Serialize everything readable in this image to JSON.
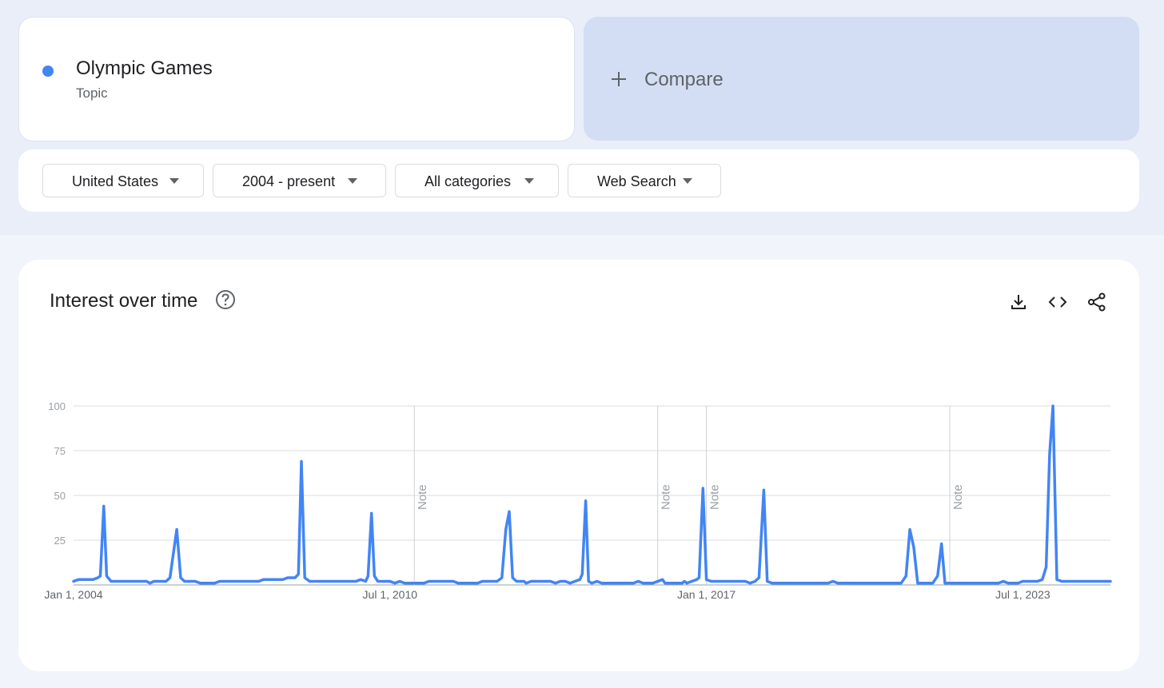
{
  "search_term": {
    "name": "Olympic Games",
    "type": "Topic",
    "color": "#4285f4"
  },
  "compare": {
    "label": "Compare",
    "icon": "plus-icon"
  },
  "filters": {
    "region": "United States",
    "time_range": "2004 - present",
    "category": "All categories",
    "search_type": "Web Search"
  },
  "chart_panel": {
    "title": "Interest over time",
    "icons": [
      "help-icon",
      "download-icon",
      "embed-code-icon",
      "share-icon"
    ]
  },
  "chart_data": {
    "type": "line",
    "title": "Interest over time",
    "xlabel": "",
    "ylabel": "",
    "ylim": [
      0,
      100
    ],
    "yticks": [
      25,
      50,
      75,
      100
    ],
    "xticks": [
      {
        "label": "Jan 1, 2004",
        "t": 2004.0
      },
      {
        "label": "Jul 1, 2010",
        "t": 2010.5
      },
      {
        "label": "Jan 1, 2017",
        "t": 2017.0
      },
      {
        "label": "Jul 1, 2023",
        "t": 2023.5
      }
    ],
    "notes": [
      {
        "label": "Note",
        "t": 2011.0
      },
      {
        "label": "Note",
        "t": 2016.0
      },
      {
        "label": "Note",
        "t": 2017.0
      },
      {
        "label": "Note",
        "t": 2022.0
      }
    ],
    "grid": true,
    "line_color": "#4285f4",
    "series": [
      {
        "points": [
          [
            2004.0,
            2
          ],
          [
            2004.1,
            3
          ],
          [
            2004.4,
            3
          ],
          [
            2004.5,
            4
          ],
          [
            2004.55,
            5
          ],
          [
            2004.62,
            44
          ],
          [
            2004.68,
            5
          ],
          [
            2004.77,
            2
          ],
          [
            2005.5,
            2
          ],
          [
            2005.57,
            1
          ],
          [
            2005.65,
            2
          ],
          [
            2005.9,
            2
          ],
          [
            2005.98,
            4
          ],
          [
            2006.12,
            31
          ],
          [
            2006.2,
            4
          ],
          [
            2006.28,
            2
          ],
          [
            2006.5,
            2
          ],
          [
            2006.6,
            1
          ],
          [
            2006.9,
            1
          ],
          [
            2007.0,
            2
          ],
          [
            2007.8,
            2
          ],
          [
            2007.9,
            3
          ],
          [
            2008.3,
            3
          ],
          [
            2008.4,
            4
          ],
          [
            2008.55,
            4
          ],
          [
            2008.62,
            6
          ],
          [
            2008.68,
            69
          ],
          [
            2008.75,
            4
          ],
          [
            2008.85,
            2
          ],
          [
            2009.8,
            2
          ],
          [
            2009.9,
            3
          ],
          [
            2010.0,
            2
          ],
          [
            2010.05,
            5
          ],
          [
            2010.12,
            40
          ],
          [
            2010.18,
            5
          ],
          [
            2010.25,
            2
          ],
          [
            2010.5,
            2
          ],
          [
            2010.6,
            1
          ],
          [
            2010.7,
            2
          ],
          [
            2010.8,
            1
          ],
          [
            2011.2,
            1
          ],
          [
            2011.3,
            2
          ],
          [
            2011.8,
            2
          ],
          [
            2011.9,
            1
          ],
          [
            2012.3,
            1
          ],
          [
            2012.4,
            2
          ],
          [
            2012.7,
            2
          ],
          [
            2012.8,
            4
          ],
          [
            2012.88,
            31
          ],
          [
            2012.95,
            41
          ],
          [
            2013.02,
            4
          ],
          [
            2013.1,
            2
          ],
          [
            2013.25,
            2
          ],
          [
            2013.3,
            1
          ],
          [
            2013.4,
            2
          ],
          [
            2013.8,
            2
          ],
          [
            2013.9,
            1
          ],
          [
            2014.0,
            2
          ],
          [
            2014.1,
            2
          ],
          [
            2014.2,
            1
          ],
          [
            2014.3,
            2
          ],
          [
            2014.4,
            3
          ],
          [
            2014.45,
            6
          ],
          [
            2014.52,
            47
          ],
          [
            2014.58,
            2
          ],
          [
            2014.65,
            1
          ],
          [
            2014.75,
            2
          ],
          [
            2014.85,
            1
          ],
          [
            2015.5,
            1
          ],
          [
            2015.6,
            2
          ],
          [
            2015.7,
            1
          ],
          [
            2015.9,
            1
          ],
          [
            2016.0,
            2
          ],
          [
            2016.1,
            3
          ],
          [
            2016.15,
            1
          ],
          [
            2016.5,
            1
          ],
          [
            2016.55,
            2
          ],
          [
            2016.6,
            1
          ],
          [
            2016.7,
            2
          ],
          [
            2016.8,
            3
          ],
          [
            2016.85,
            4
          ],
          [
            2016.93,
            54
          ],
          [
            2017.0,
            3
          ],
          [
            2017.1,
            2
          ],
          [
            2017.8,
            2
          ],
          [
            2017.9,
            1
          ],
          [
            2018.0,
            2
          ],
          [
            2018.08,
            4
          ],
          [
            2018.18,
            53
          ],
          [
            2018.25,
            2
          ],
          [
            2018.35,
            1
          ],
          [
            2019.5,
            1
          ],
          [
            2019.6,
            2
          ],
          [
            2019.7,
            1
          ],
          [
            2021.0,
            1
          ],
          [
            2021.1,
            5
          ],
          [
            2021.18,
            31
          ],
          [
            2021.26,
            21
          ],
          [
            2021.34,
            1
          ],
          [
            2021.65,
            1
          ],
          [
            2021.75,
            5
          ],
          [
            2021.83,
            23
          ],
          [
            2021.9,
            1
          ],
          [
            2023.0,
            1
          ],
          [
            2023.1,
            2
          ],
          [
            2023.2,
            1
          ],
          [
            2023.4,
            1
          ],
          [
            2023.5,
            2
          ],
          [
            2023.8,
            2
          ],
          [
            2023.9,
            3
          ],
          [
            2023.98,
            10
          ],
          [
            2024.05,
            73
          ],
          [
            2024.12,
            100
          ],
          [
            2024.2,
            3
          ],
          [
            2024.3,
            2
          ],
          [
            2025.3,
            2
          ]
        ]
      }
    ]
  }
}
